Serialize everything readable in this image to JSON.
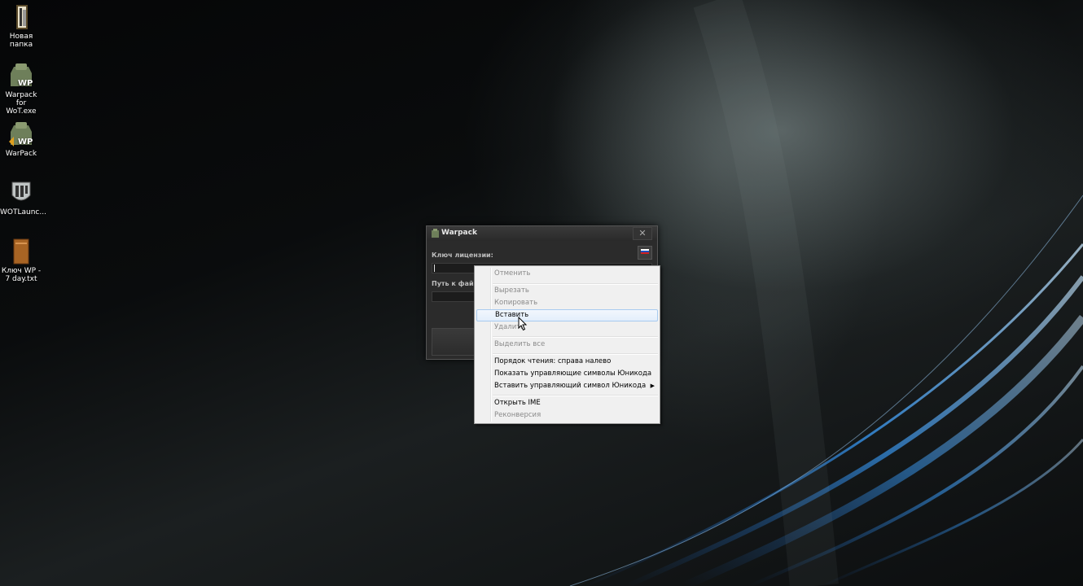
{
  "desktop": {
    "icons": [
      {
        "label": "Новая папка",
        "icon": "folder-icon"
      },
      {
        "label": "Warpack for WoT.exe",
        "icon": "warpack-icon"
      },
      {
        "label": "WarPack",
        "icon": "warpack-icon"
      },
      {
        "label": "WOTLaunc...",
        "icon": "wot-launcher-icon"
      },
      {
        "label": "Ключ WP - 7 day.txt",
        "icon": "text-file-icon"
      }
    ]
  },
  "app_window": {
    "title": "Warpack",
    "license_label": "Ключ лицензии:",
    "license_value": "",
    "path_label": "Путь к файлу",
    "language": "ru"
  },
  "context_menu": {
    "items": [
      {
        "label": "Отменить",
        "enabled": false
      },
      {
        "label": "Вырезать",
        "enabled": false
      },
      {
        "label": "Копировать",
        "enabled": false
      },
      {
        "label": "Вставить",
        "enabled": true,
        "highlighted": true
      },
      {
        "label": "Удалить",
        "enabled": false
      },
      {
        "label": "Выделить все",
        "enabled": false
      },
      {
        "label": "Порядок чтения: справа налево",
        "enabled": true
      },
      {
        "label": "Показать управляющие символы Юникода",
        "enabled": true
      },
      {
        "label": "Вставить управляющий символ Юникода",
        "enabled": true,
        "submenu": true
      },
      {
        "label": "Открыть IME",
        "enabled": true
      },
      {
        "label": "Реконверсия",
        "enabled": false
      }
    ]
  },
  "colors": {
    "menu_bg": "#f0f0f0",
    "menu_highlight": "#e3eefb",
    "window_bg": "#2b2b2b",
    "swoosh_blue": "#3aa0ff"
  }
}
